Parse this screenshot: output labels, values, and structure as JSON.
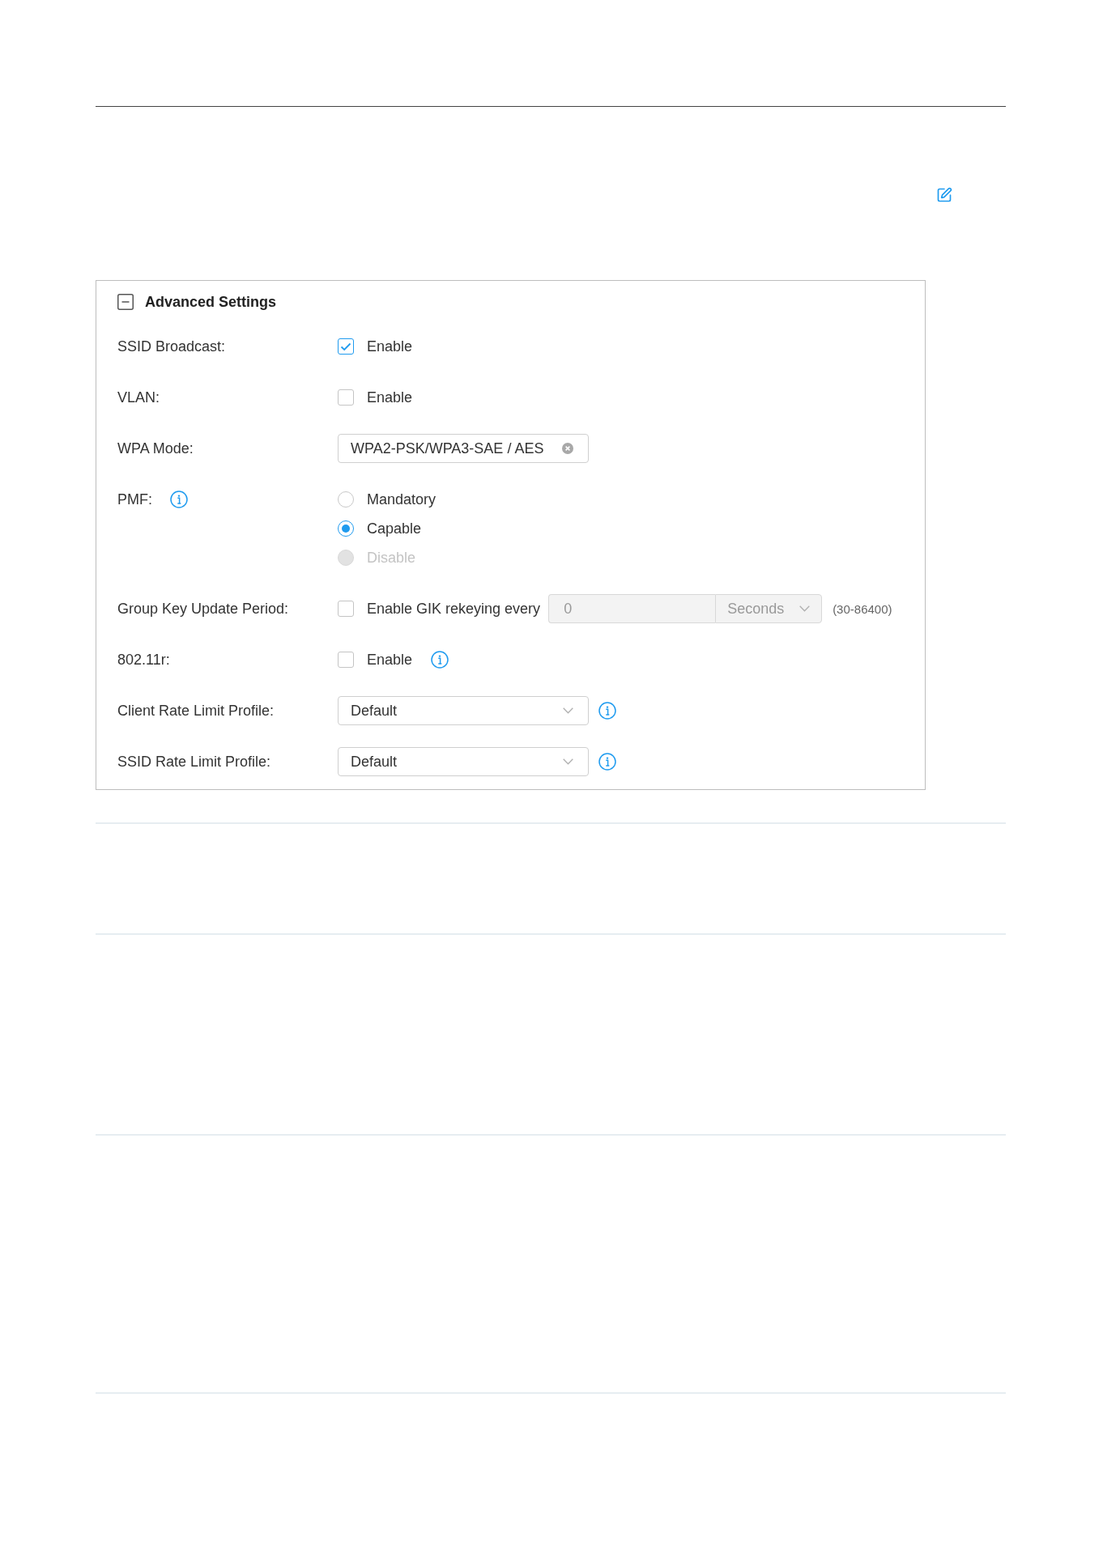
{
  "panel": {
    "title": "Advanced Settings",
    "expanded": true,
    "rows": [
      {
        "kind": "checkbox",
        "label": "SSID Broadcast:",
        "option": "Enable",
        "checked": true,
        "info": false
      },
      {
        "kind": "checkbox",
        "label": "VLAN:",
        "option": "Enable",
        "checked": false,
        "info": false
      },
      {
        "kind": "select",
        "label": "WPA Mode:",
        "value": "WPA2-PSK/WPA3-SAE / AES",
        "clearable": true,
        "info": false
      },
      {
        "kind": "radio",
        "label": "PMF:",
        "info": true,
        "options": [
          {
            "label": "Mandatory",
            "selected": false,
            "disabled": false
          },
          {
            "label": "Capable",
            "selected": true,
            "disabled": false
          },
          {
            "label": "Disable",
            "selected": false,
            "disabled": true
          }
        ]
      },
      {
        "kind": "rekey",
        "label": "Group Key Update Period:",
        "option": "Enable GIK rekeying every",
        "checked": false,
        "value": "0",
        "unit": "Seconds",
        "disabled": true,
        "range": "(30-86400)",
        "info": false
      },
      {
        "kind": "checkbox",
        "label": "802.11r:",
        "option": "Enable",
        "checked": false,
        "info": true
      },
      {
        "kind": "select",
        "label": "Client Rate Limit Profile:",
        "value": "Default",
        "clearable": false,
        "info": true
      },
      {
        "kind": "select",
        "label": "SSID Rate Limit Profile:",
        "value": "Default",
        "clearable": false,
        "info": true
      }
    ]
  }
}
